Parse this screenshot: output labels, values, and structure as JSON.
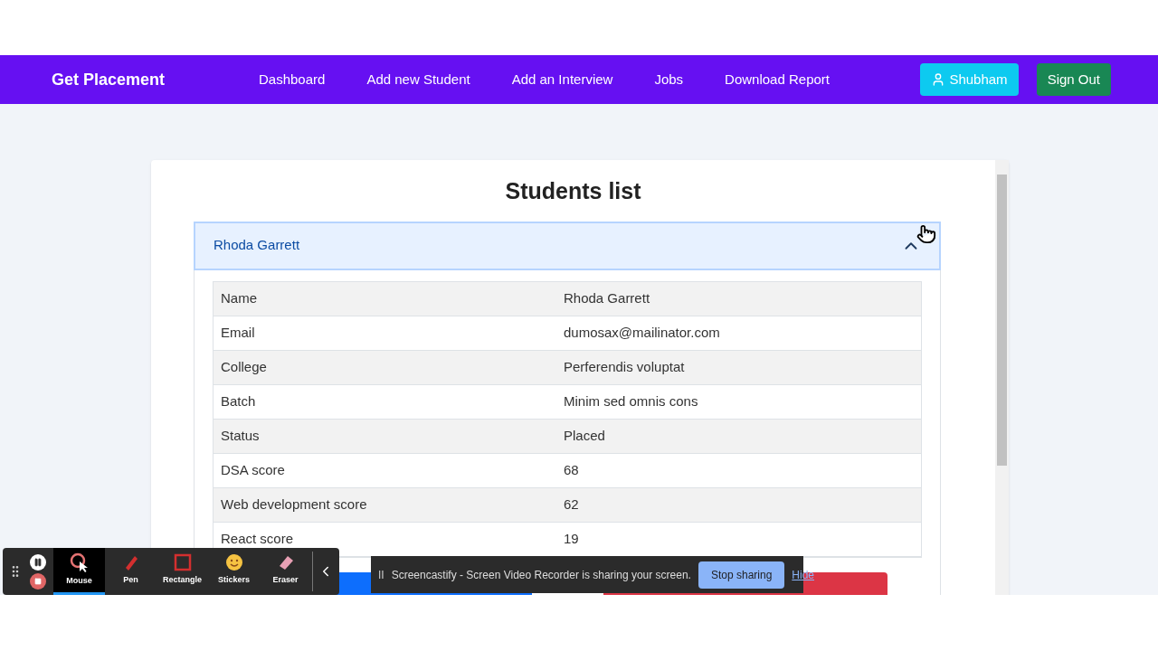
{
  "navbar": {
    "brand": "Get Placement",
    "links": [
      "Dashboard",
      "Add new Student",
      "Add an Interview",
      "Jobs",
      "Download Report"
    ],
    "user_button": "Shubham",
    "signout_button": "Sign Out"
  },
  "card": {
    "title": "Students list",
    "accordion": {
      "name": "Rhoda Garrett",
      "expanded": true
    },
    "rows": [
      {
        "label": "Name",
        "value": "Rhoda Garrett"
      },
      {
        "label": "Email",
        "value": "dumosax@mailinator.com"
      },
      {
        "label": "College",
        "value": "Perferendis voluptat"
      },
      {
        "label": "Batch",
        "value": "Minim sed omnis cons"
      },
      {
        "label": "Status",
        "value": "Placed"
      },
      {
        "label": "DSA score",
        "value": "68"
      },
      {
        "label": "Web development score",
        "value": "62"
      },
      {
        "label": "React score",
        "value": "19"
      }
    ]
  },
  "recorder_toolbar": {
    "tools": [
      {
        "kind": "mouse",
        "label": "Mouse",
        "selected": true
      },
      {
        "kind": "pen",
        "label": "Pen",
        "selected": false
      },
      {
        "kind": "rectangle",
        "label": "Rectangle",
        "selected": false
      },
      {
        "kind": "stickers",
        "label": "Stickers",
        "selected": false
      },
      {
        "kind": "eraser",
        "label": "Eraser",
        "selected": false
      }
    ]
  },
  "sharing_banner": {
    "pause_glyph": "II",
    "message": "Screencastify - Screen Video Recorder is sharing your screen.",
    "stop_button": "Stop sharing",
    "hide_link": "Hide"
  }
}
